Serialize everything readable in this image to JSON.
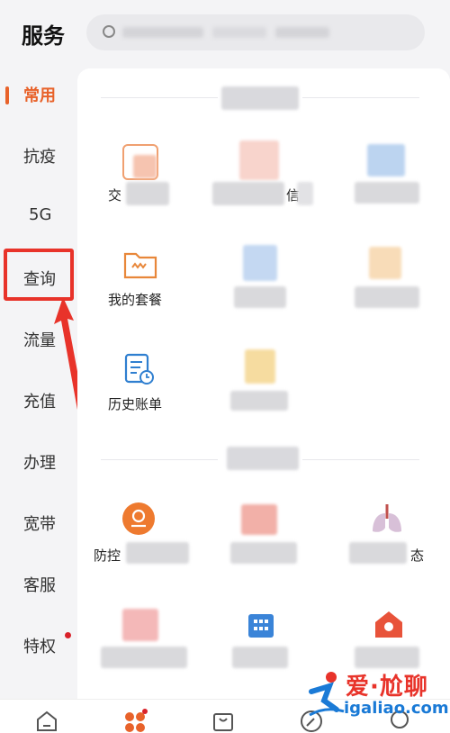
{
  "header": {
    "title": "服务"
  },
  "sidebar": {
    "items": [
      {
        "label": "常用"
      },
      {
        "label": "抗疫"
      },
      {
        "label": "5G"
      },
      {
        "label": "查询"
      },
      {
        "label": "流量"
      },
      {
        "label": "充值"
      },
      {
        "label": "办理"
      },
      {
        "label": "宽带"
      },
      {
        "label": "客服"
      },
      {
        "label": "特权"
      }
    ]
  },
  "grid": {
    "tiles": [
      {
        "label": "交"
      },
      {
        "label": "信"
      },
      {
        "label": ""
      },
      {
        "label": "我的套餐"
      },
      {
        "label": ""
      },
      {
        "label": ""
      },
      {
        "label": "历史账单"
      },
      {
        "label": ""
      },
      {
        "label": "防控"
      },
      {
        "label": ""
      },
      {
        "label": "态"
      },
      {
        "label": ""
      },
      {
        "label": ""
      },
      {
        "label": ""
      }
    ]
  },
  "watermark": {
    "brand": "爱·尬聊",
    "url": "igaliao.com"
  },
  "colors": {
    "accent": "#e8622a",
    "highlight": "#e8332a",
    "badge": "#d9222a"
  }
}
